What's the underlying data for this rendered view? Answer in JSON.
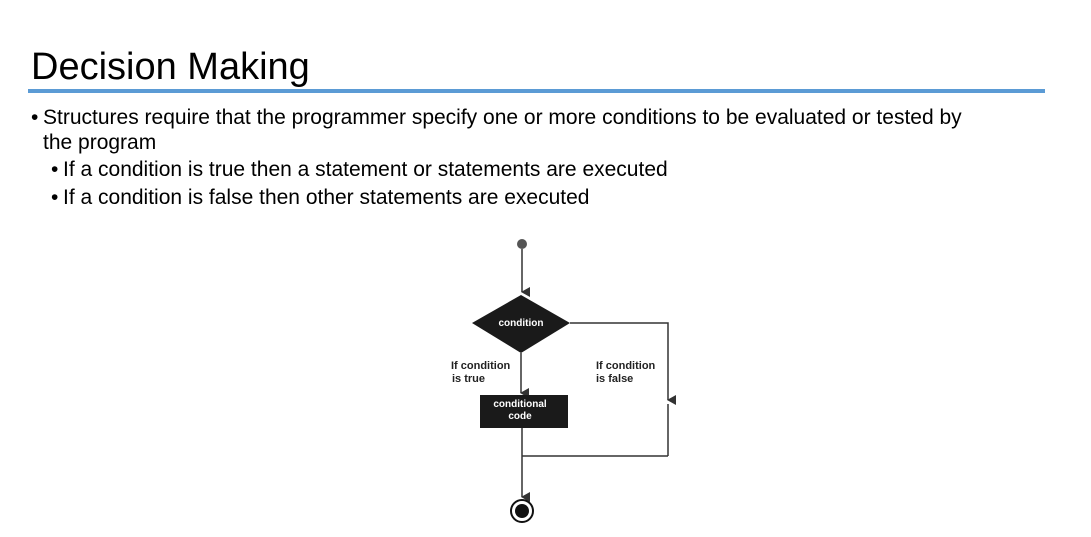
{
  "slide": {
    "title": "Decision Making",
    "bullets": [
      {
        "text": "Structures require that the programmer specify one or more conditions to be evaluated or tested by",
        "continuation": "the program"
      },
      {
        "text": "If a condition is true then a statement or statements are executed"
      },
      {
        "text": "If a condition is false then other statements are executed"
      }
    ],
    "bullet_glyph": "•"
  },
  "flowchart": {
    "decision_label": "condition",
    "true_label_line1": "If condition",
    "true_label_line2": "is true",
    "false_label_line1": "If condition",
    "false_label_line2": "is false",
    "process_label_line1": "conditional",
    "process_label_line2": "code"
  },
  "colors": {
    "title_rule": "#5b9bd5",
    "shape_fill": "#1a1a1a",
    "line": "#333333"
  }
}
